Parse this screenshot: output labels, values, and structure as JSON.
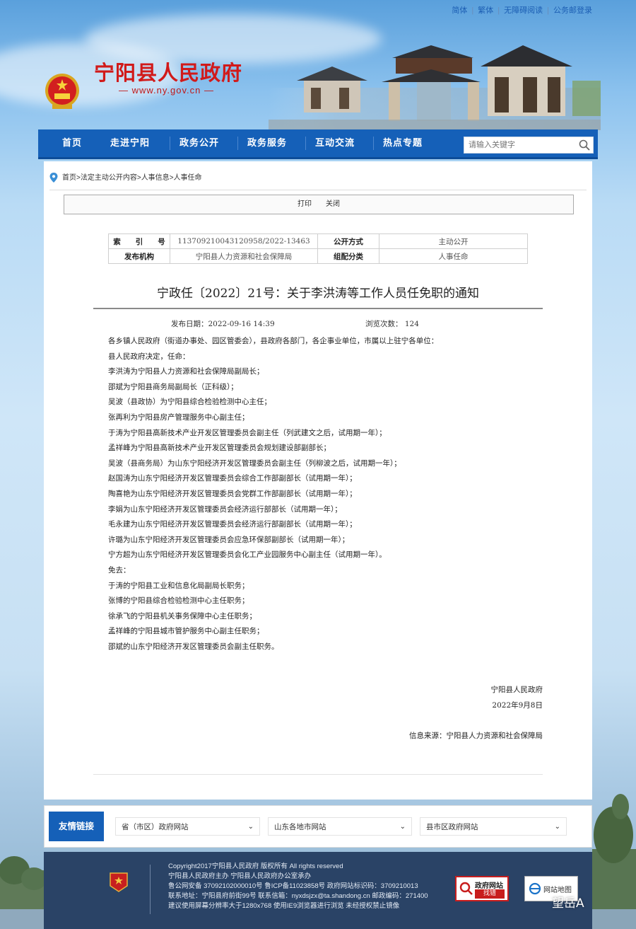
{
  "topbar": {
    "links": [
      "简体",
      "繁体",
      "无障碍阅读",
      "公务邮登录"
    ]
  },
  "header": {
    "title": "宁阳县人民政府",
    "url": "— www.ny.gov.cn —"
  },
  "nav": {
    "items": [
      "首页",
      "走进宁阳",
      "政务公开",
      "政务服务",
      "互动交流",
      "热点专题"
    ],
    "search_placeholder": "请输入关键字"
  },
  "breadcrumb": {
    "items": [
      "首页",
      "法定主动公开内容",
      "人事信息",
      "人事任命"
    ]
  },
  "toolbar": {
    "print": "打印",
    "close": "关闭"
  },
  "meta": {
    "index_label": "索　　引　　号",
    "index_value": "11370921004312095​8/2022-13463",
    "open_label": "公开方式",
    "open_value": "主动公开",
    "publisher_label": "发布机构",
    "publisher_value": "宁阳县人力资源和社会保障局",
    "category_label": "组配分类",
    "category_value": "人事任命"
  },
  "doc": {
    "title": "宁政任〔2022〕21号：关于李洪涛等工作人员任免职的通知",
    "date_label": "发布日期：2022-09-16 14:39",
    "views_label": "浏览次数：  124",
    "lines": [
      "各乡镇人民政府（街道办事处、园区管委会），县政府各部门，各企事业单位，市属以上驻宁各单位：",
      "县人民政府决定，任命：",
      "李洪涛为宁阳县人力资源和社会保障局副局长；",
      "邵斌为宁阳县商务局副局长（正科级）；",
      "吴波（县政协）为宁阳县综合检验检测中心主任；",
      "张再利为宁阳县房产管理服务中心副主任；",
      "于涛为宁阳县高新技术产业开发区管理委员会副主任（列武建文之后，试用期一年）；",
      "孟祥峰为宁阳县高新技术产业开发区管理委员会规划建设部副部长；",
      "吴波（县商务局）为山东宁阳经济开发区管理委员会副主任（列柳波之后，试用期一年）；",
      "赵国涛为山东宁阳经济开发区管理委员会综合工作部副部长（试用期一年）；",
      "陶喜艳为山东宁阳经济开发区管理委员会党群工作部副部长（试用期一年）；",
      "李娟为山东宁阳经济开发区管理委员会经济运行部部长（试用期一年）；",
      "毛永建为山东宁阳经济开发区管理委员会经济运行部副部长（试用期一年）；",
      "许璐为山东宁阳经济开发区管理委员会应急环保部副部长（试用期一年）；",
      "宁方超为山东宁阳经济开发区管理委员会化工产业园服务中心副主任（试用期一年）。",
      "免去：",
      "于涛的宁阳县工业和信息化局副局长职务；",
      "张博的宁阳县综合检验检测中心主任职务；",
      "徐承飞的宁阳县机关事务保障中心主任职务；",
      "孟祥峰的宁阳县城市管护服务中心副主任职务；",
      "邵斌的山东宁阳经济开发区管理委员会副主任职务。"
    ],
    "signer": "宁阳县人民政府",
    "sign_date": "2022年9月8日",
    "source": "信息来源：宁阳县人力资源和社会保障局"
  },
  "links": {
    "label": "友情链接",
    "selects": [
      "省（市区）政府网站",
      "山东各地市网站",
      "县市区政府网站"
    ]
  },
  "footer": {
    "lines": [
      "Copyright2017宁阳县人民政府 版权所有 All rights reserved",
      "宁阳县人民政府主办 宁阳县人民政府办公室承办",
      "鲁公网安备 37092102000010号 鲁ICP备11023858号 政府网站标识码：3709210013",
      "联系地址：宁阳县府前街99号 联系信箱：nyxdsjzx@ta.shandong.cn 邮政编码：271400",
      "建议使用屏幕分辨率大于1280x768 使用IE9浏览器进行浏览 未经授权禁止镜像"
    ],
    "badge1_top": "政府网站",
    "badge1_bottom": "找错",
    "badge2": "网站地图"
  },
  "watermark": "望岳A",
  "colors": {
    "nav": "#1560b8",
    "title_red": "#d11a1a",
    "footer": "#2a4366"
  }
}
